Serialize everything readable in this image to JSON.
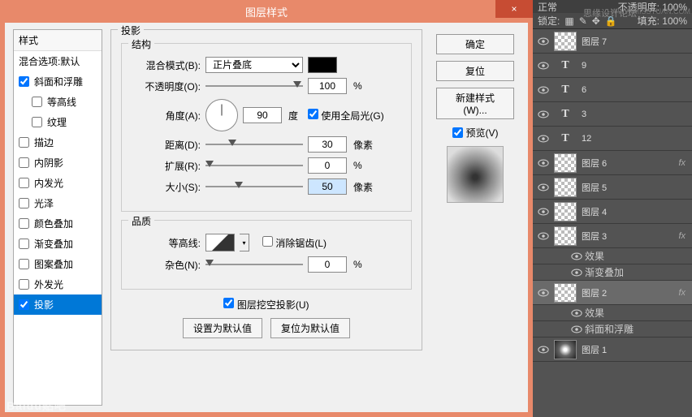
{
  "dialog": {
    "title": "图层样式",
    "close": "×",
    "styles_header": "样式",
    "styles": [
      {
        "label": "混合选项:默认",
        "checkbox": false
      },
      {
        "label": "斜面和浮雕",
        "checkbox": true,
        "checked": true
      },
      {
        "label": "等高线",
        "checkbox": true,
        "checked": false,
        "indent": true
      },
      {
        "label": "纹理",
        "checkbox": true,
        "checked": false,
        "indent": true
      },
      {
        "label": "描边",
        "checkbox": true,
        "checked": false
      },
      {
        "label": "内阴影",
        "checkbox": true,
        "checked": false
      },
      {
        "label": "内发光",
        "checkbox": true,
        "checked": false
      },
      {
        "label": "光泽",
        "checkbox": true,
        "checked": false
      },
      {
        "label": "颜色叠加",
        "checkbox": true,
        "checked": false
      },
      {
        "label": "渐变叠加",
        "checkbox": true,
        "checked": false
      },
      {
        "label": "图案叠加",
        "checkbox": true,
        "checked": false
      },
      {
        "label": "外发光",
        "checkbox": true,
        "checked": false
      },
      {
        "label": "投影",
        "checkbox": true,
        "checked": true,
        "selected": true
      }
    ],
    "main_legend": "投影",
    "struct_legend": "结构",
    "quality_legend": "品质",
    "blend_mode_label": "混合模式(B):",
    "blend_mode_value": "正片叠底",
    "opacity_label": "不透明度(O):",
    "opacity_value": "100",
    "percent": "%",
    "angle_label": "角度(A):",
    "angle_value": "90",
    "degree": "度",
    "global_light": "使用全局光(G)",
    "distance_label": "距离(D):",
    "distance_value": "30",
    "px": "像素",
    "spread_label": "扩展(R):",
    "spread_value": "0",
    "size_label": "大小(S):",
    "size_value": "50",
    "contour_label": "等高线:",
    "antialias": "消除锯齿(L)",
    "noise_label": "杂色(N):",
    "noise_value": "0",
    "knockout": "图层挖空投影(U)",
    "btn_default": "设置为默认值",
    "btn_reset_default": "复位为默认值",
    "btn_ok": "确定",
    "btn_reset": "复位",
    "btn_newstyle": "新建样式(W)...",
    "preview": "预览(V)"
  },
  "layers_panel": {
    "top_left": "正常",
    "top_right": "不透明度: 100%",
    "watermark_site": "思缘设计论坛",
    "url": "WWW.MISSYUAN.COM",
    "lock_label": "锁定:",
    "fill_label": "填充: 100%",
    "layers": [
      {
        "type": "checker",
        "name": "图层 7"
      },
      {
        "type": "text",
        "name": "9"
      },
      {
        "type": "text",
        "name": "6"
      },
      {
        "type": "text",
        "name": "3"
      },
      {
        "type": "text",
        "name": "12"
      },
      {
        "type": "checker",
        "name": "图层 6",
        "fx": true
      },
      {
        "type": "checker",
        "name": "图层 5"
      },
      {
        "type": "checker",
        "name": "图层 4"
      },
      {
        "type": "checker",
        "name": "图层 3",
        "fx": true,
        "sub": [
          "效果",
          "渐变叠加"
        ]
      },
      {
        "type": "checker",
        "name": "图层 2",
        "fx": true,
        "sel": true,
        "sub": [
          "效果",
          "斜面和浮雕"
        ]
      },
      {
        "type": "glow",
        "name": "图层 1"
      }
    ]
  },
  "watermark": "Baidu贴吧"
}
